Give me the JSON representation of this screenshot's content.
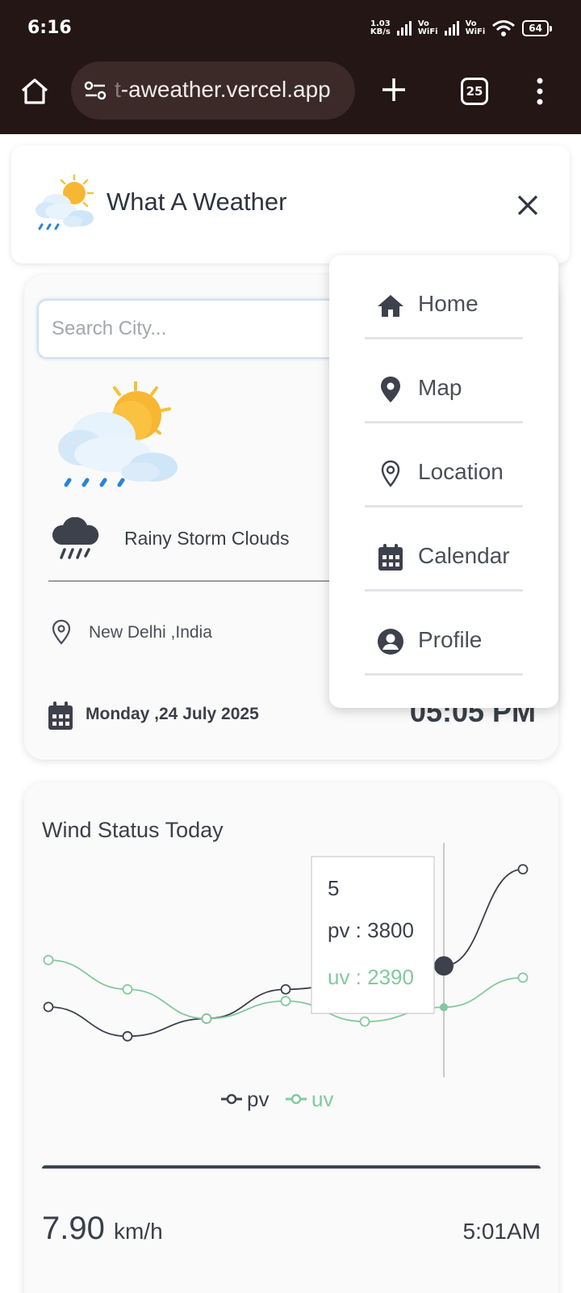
{
  "status_bar": {
    "time": "6:16",
    "net_speed_value": "1.03",
    "net_speed_unit": "KB/s",
    "wifi_label_top": "Vo",
    "wifi_label_bottom": "WiFi",
    "battery": "64"
  },
  "browser": {
    "url_prefix": "t",
    "url": "-aweather.vercel.app",
    "tab_count": "25"
  },
  "header": {
    "title": "What A Weather"
  },
  "search": {
    "placeholder": "Search City..."
  },
  "weather": {
    "condition": "Rainy Storm Clouds",
    "location": "New Delhi ,India",
    "date": "Monday ,24 July 2025",
    "time": "05:05 PM"
  },
  "menu": {
    "items": [
      {
        "label": "Home",
        "icon": "home-icon"
      },
      {
        "label": "Map",
        "icon": "map-marker-icon"
      },
      {
        "label": "Location",
        "icon": "location-pin-icon"
      },
      {
        "label": "Calendar",
        "icon": "calendar-icon"
      },
      {
        "label": "Profile",
        "icon": "user-circle-icon"
      }
    ]
  },
  "wind": {
    "title": "Wind Status Today",
    "speed": "7.90",
    "unit": "km/h",
    "time": "5:01AM"
  },
  "chart_data": {
    "type": "line",
    "title": "Wind Status Today",
    "x": [
      0,
      1,
      2,
      3,
      4,
      5,
      6
    ],
    "series": [
      {
        "name": "pv",
        "color": "#3d414c",
        "values": [
          2400,
          1398,
          2000,
          3000,
          3300,
          3800,
          7100
        ]
      },
      {
        "name": "uv",
        "color": "#82ca9d",
        "values": [
          4000,
          3000,
          2000,
          2600,
          1900,
          2390,
          3400
        ]
      }
    ],
    "ylim": [
      0,
      8000
    ],
    "tooltip": {
      "x": "5",
      "lines": [
        "pv : 3800",
        "uv : 2390"
      ]
    },
    "legend": "bottom-center",
    "grid": false
  }
}
